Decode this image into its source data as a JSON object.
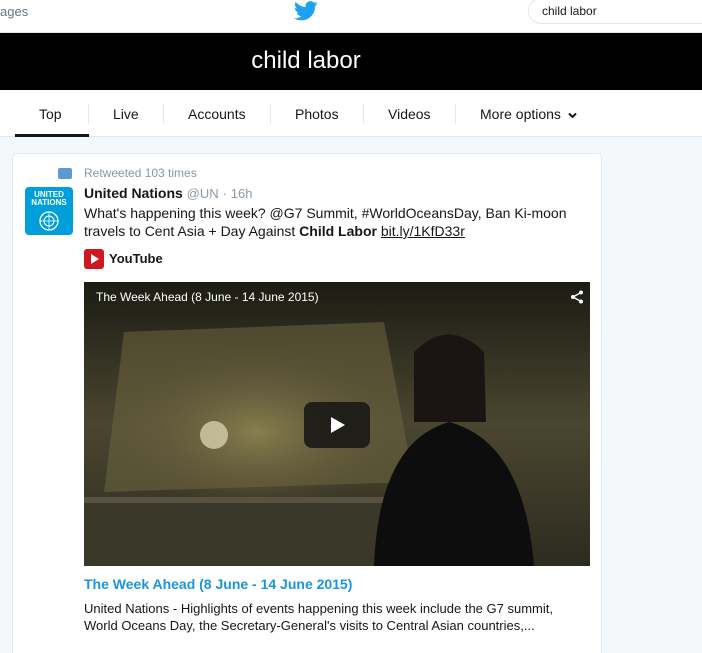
{
  "topnav": {
    "left_text": "ages",
    "logo_icon": "twitter-bird-icon",
    "search_value": "child labor"
  },
  "banner": {
    "query": "child labor"
  },
  "tabs": [
    {
      "label": "Top",
      "active": true
    },
    {
      "label": "Live"
    },
    {
      "label": "Accounts"
    },
    {
      "label": "Photos"
    },
    {
      "label": "Videos"
    },
    {
      "label": "More options"
    }
  ],
  "tweet": {
    "retweet_text": "Retweeted 103 times",
    "avatar_line1": "UNITED",
    "avatar_line2": "NATIONS",
    "name": "United Nations",
    "handle": "@UN",
    "separator": "·",
    "time": "16h",
    "text_before": "What's happening this week? @G7 Summit, #WorldOceansDay, Ban Ki-moon travels to Cent Asia + Day Against ",
    "text_bold": "Child Labor",
    "link": "bit.ly/1KfD33r",
    "source": "YouTube",
    "video_title": "The Week Ahead (8 June - 14 June 2015)",
    "card_title": "The Week Ahead (8 June - 14 June 2015)",
    "card_description": "United Nations - Highlights of events happening this week include the G7 summit, World Oceans Day, the Secretary-General's visits to Central Asian countries,..."
  },
  "colors": {
    "accent": "#1b95e0",
    "un_blue": "#009edb",
    "youtube_red": "#cc181e",
    "banner": "#000000"
  }
}
